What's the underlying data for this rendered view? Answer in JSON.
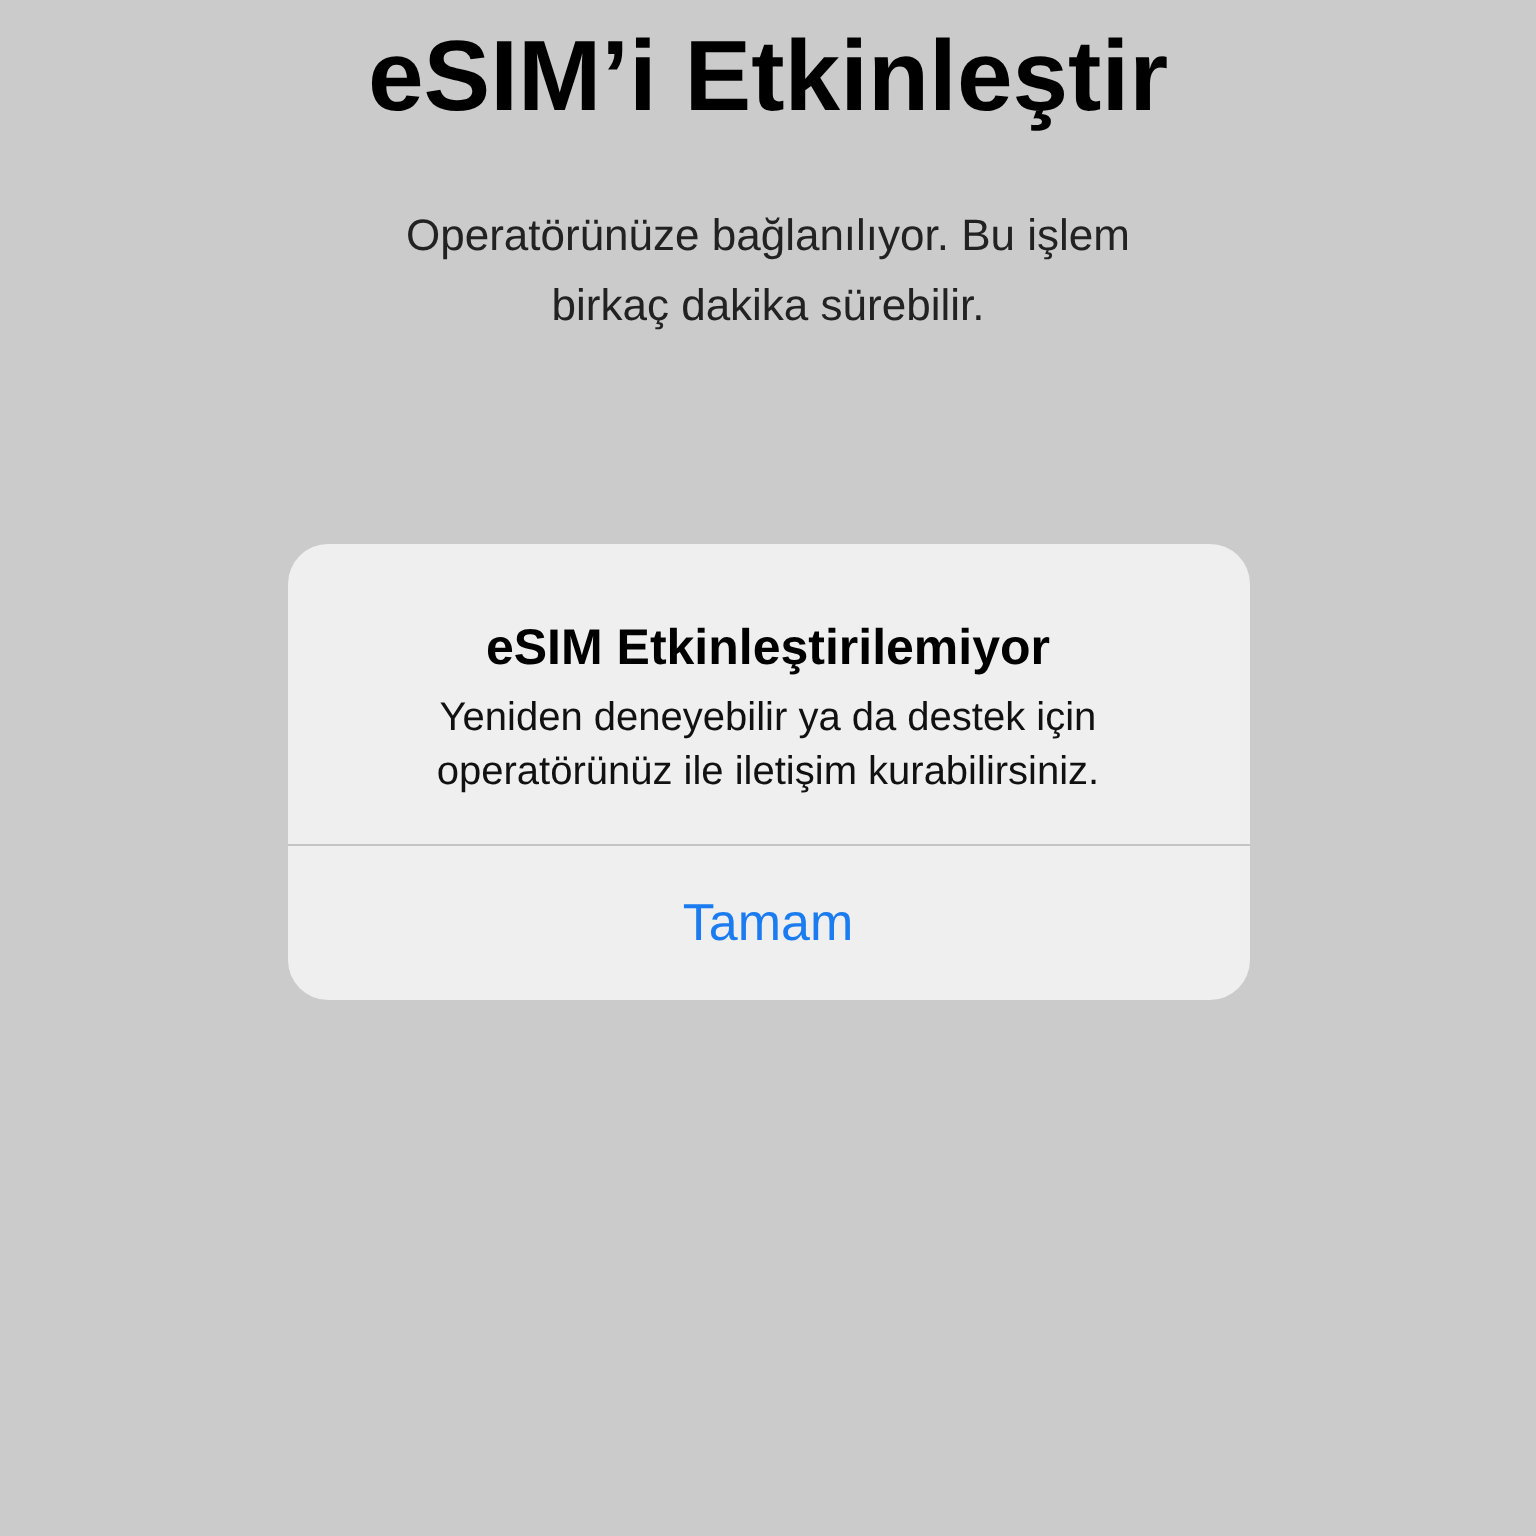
{
  "screen": {
    "title": "eSIM’i Etkinleştir",
    "subtitle": "Operatörünüze bağlanılıyor. Bu işlem birkaç dakika sürebilir."
  },
  "alert": {
    "title": "eSIM Etkinleştirilemiyor",
    "message": "Yeniden deneyebilir ya da destek için operatörünüz ile iletişim kurabilirsiniz.",
    "buttons": [
      "Tamam"
    ]
  }
}
